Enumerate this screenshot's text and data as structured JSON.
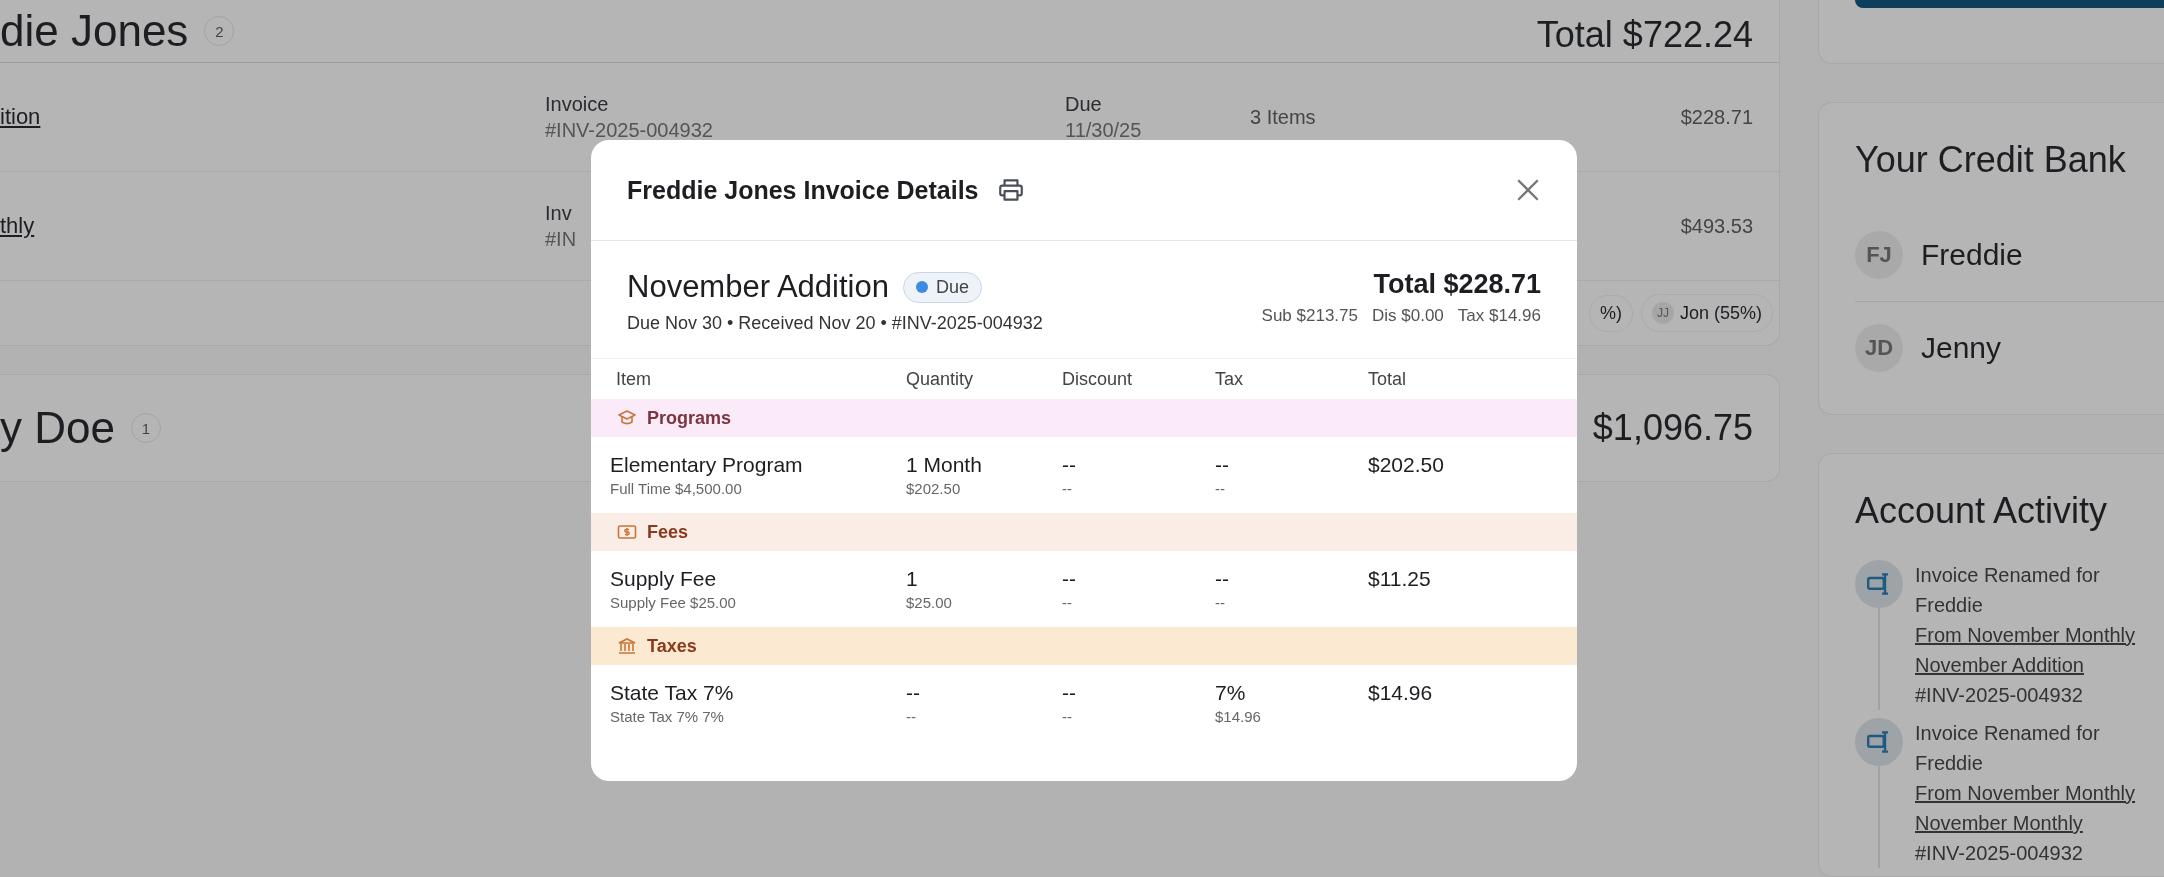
{
  "background": {
    "customer_card": {
      "name": "die Jones",
      "count": "2",
      "total": "Total $722.24",
      "invoices": [
        {
          "title": "ition",
          "col_label": "Invoice",
          "col_value": "#INV-2025-004932",
          "due_label": "Due",
          "due_value": "11/30/25",
          "items": "3 Items",
          "amount": "$228.71"
        },
        {
          "title": "thly",
          "col_label": "Inv",
          "col_value": "#IN",
          "amount": "$493.53"
        }
      ],
      "splits": [
        {
          "label": "%)"
        },
        {
          "initials": "JJ",
          "label": "Jon (55%)"
        }
      ]
    },
    "second_card": {
      "name": "y Doe",
      "count": "1",
      "total": "$1,096.75"
    }
  },
  "sidebar": {
    "credit_bank": {
      "title": "Your Credit Bank",
      "members": [
        {
          "initials": "FJ",
          "name": "Freddie"
        },
        {
          "initials": "JD",
          "name": "Jenny"
        }
      ]
    },
    "activity": {
      "title": "Account Activity",
      "entries": [
        {
          "title": "Invoice Renamed for Freddie",
          "from": "From November Monthly",
          "to": "November Addition",
          "invoice": "#INV-2025-004932"
        },
        {
          "title": "Invoice Renamed for Freddie",
          "from": "From November Monthly",
          "to": "November Monthly",
          "invoice": "#INV-2025-004932"
        }
      ]
    }
  },
  "modal": {
    "title": "Freddie Jones Invoice Details",
    "invoice_name": "November Addition",
    "status": {
      "kind": "due",
      "label": "Due"
    },
    "meta": "Due Nov 30 • Received Nov 20 • #INV-2025-004932",
    "total": "Total $228.71",
    "breakdown": [
      "Sub $213.75",
      "Dis $0.00",
      "Tax $14.96"
    ],
    "columns": [
      "Item",
      "Quantity",
      "Discount",
      "Tax",
      "Total"
    ],
    "groups": [
      {
        "kind": "programs",
        "label": "Programs",
        "items": [
          {
            "name": "Elementary Program",
            "sub": "Full Time $4,500.00",
            "quantity": "1 Month",
            "quantity_sub": "$202.50",
            "discount": "--",
            "discount_sub": "--",
            "tax": "--",
            "tax_sub": "--",
            "total": "$202.50"
          }
        ]
      },
      {
        "kind": "fees",
        "label": "Fees",
        "items": [
          {
            "name": "Supply Fee",
            "sub": "Supply Fee $25.00",
            "quantity": "1",
            "quantity_sub": "$25.00",
            "discount": "--",
            "discount_sub": "--",
            "tax": "--",
            "tax_sub": "--",
            "total": "$11.25"
          }
        ]
      },
      {
        "kind": "taxes",
        "label": "Taxes",
        "items": [
          {
            "name": "State Tax 7%",
            "sub": "State Tax 7% 7%",
            "quantity": "--",
            "quantity_sub": "--",
            "discount": "--",
            "discount_sub": "--",
            "tax": "7%",
            "tax_sub": "$14.96",
            "total": "$14.96"
          }
        ]
      }
    ]
  }
}
